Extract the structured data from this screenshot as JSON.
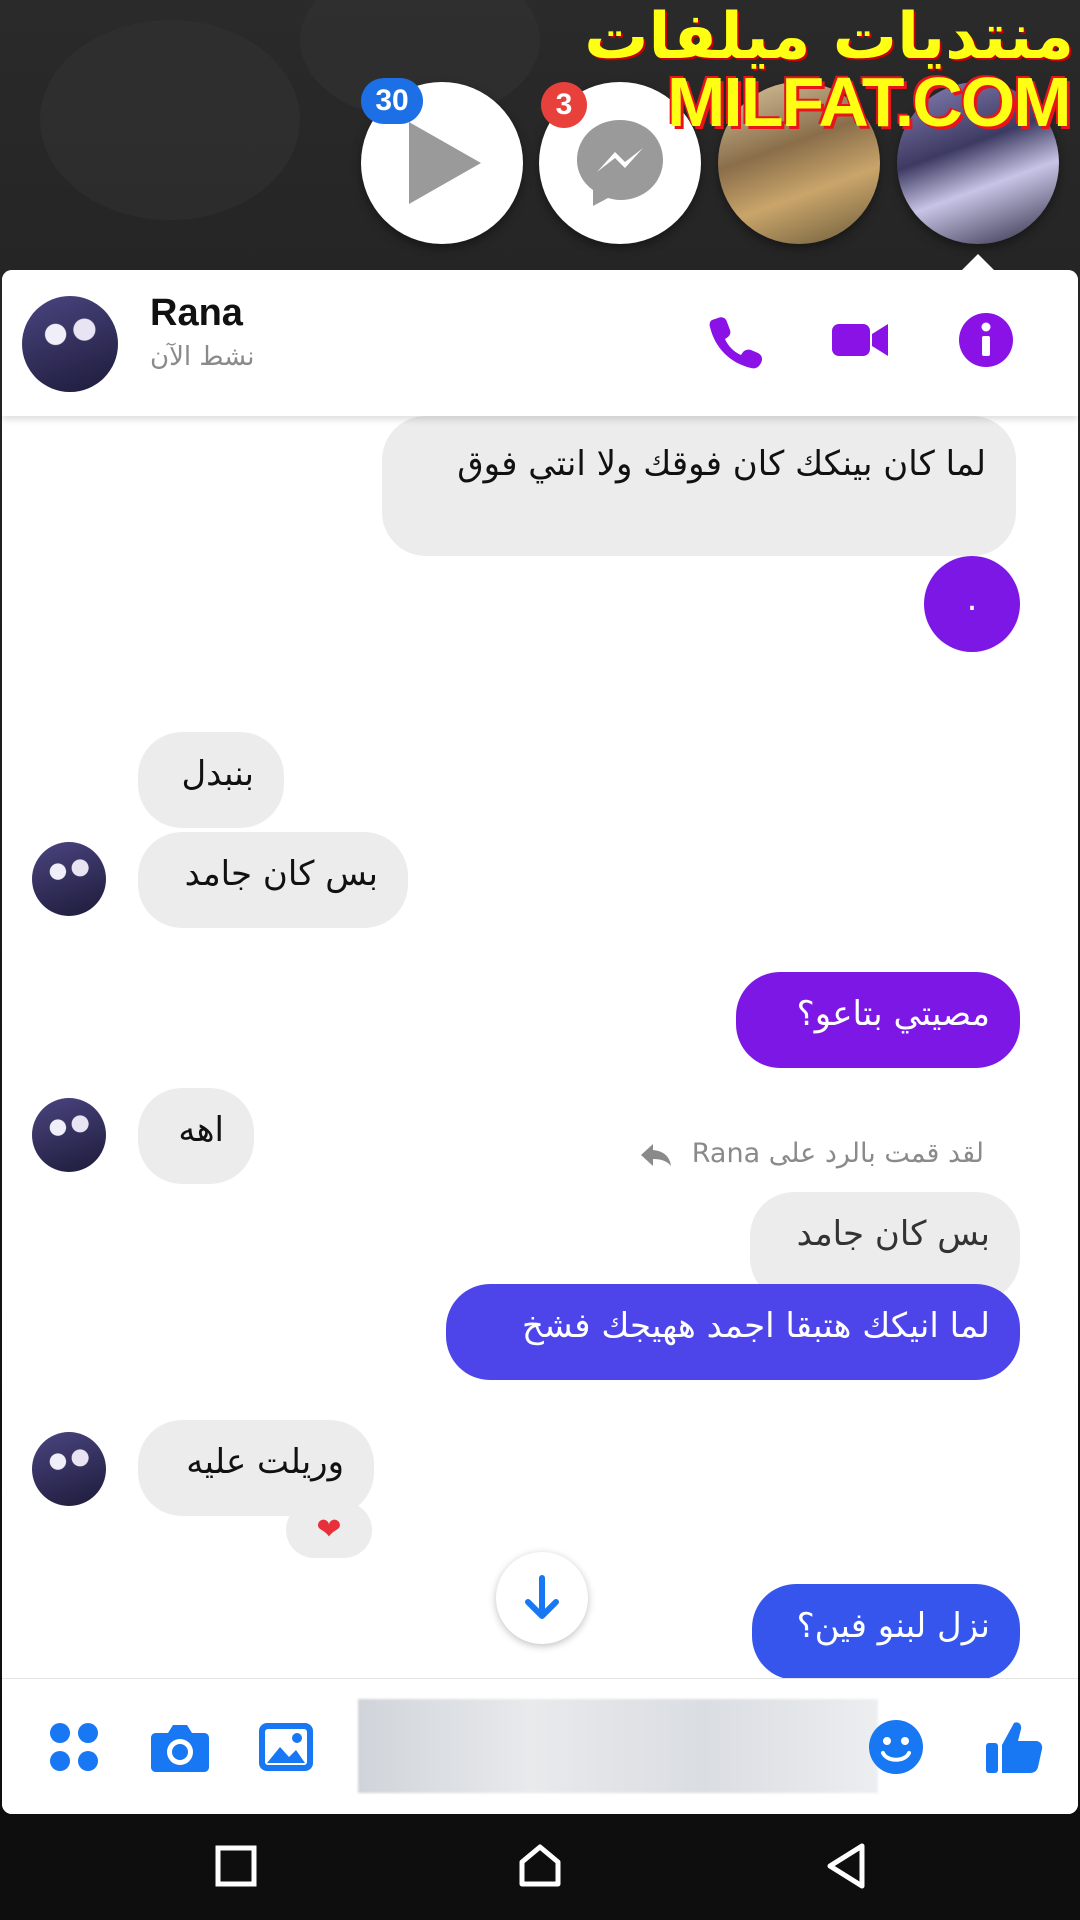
{
  "watermark": {
    "arabic": "منتديات ميلفات",
    "english": "MILFAT.COM"
  },
  "chat_heads": {
    "video_badge": "30",
    "messenger_badge": "3"
  },
  "header": {
    "name": "Rana",
    "status": "نشط الآن"
  },
  "messages": {
    "m1": "لما كان بينكك كان فوقك ولا انتي فوق",
    "m1_dot": ".",
    "m2": "بنبدل",
    "m3": "بس كان جامد",
    "m4": "مصيتي بتاعو؟",
    "m5": "اهه",
    "reply_note": "لقد قمت بالرد على Rana",
    "quoted": "بس كان جامد",
    "m6": "لما انيكك هتبقا اجمد ههيجك فشخ",
    "m7": "وريلت عليه",
    "reaction": "❤",
    "m8": "نزل لبنو فين؟"
  },
  "colors": {
    "accent": "#7c17e6",
    "bubble_in": "#ececec",
    "messenger_blue": "#1d6fe6"
  },
  "icons": [
    "play-icon",
    "messenger-icon",
    "phone-icon",
    "video-icon",
    "info-icon",
    "reply-arrow-icon",
    "arrow-down-icon",
    "apps-icon",
    "camera-icon",
    "gallery-icon",
    "emoji-icon",
    "thumbs-up-icon",
    "recents-icon",
    "home-icon",
    "back-icon"
  ]
}
